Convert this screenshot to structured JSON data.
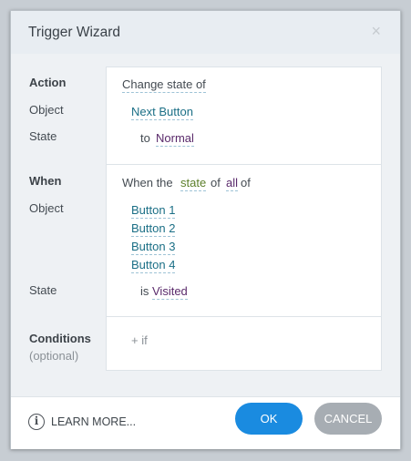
{
  "dialog": {
    "title": "Trigger Wizard",
    "close_glyph": "×"
  },
  "action_section": {
    "heading": "Action",
    "object_label": "Object",
    "state_label": "State",
    "action_value": "Change state of",
    "object_value": "Next Button",
    "state_prefix": "to",
    "state_value": "Normal"
  },
  "when_section": {
    "heading": "When",
    "object_label": "Object",
    "state_label": "State",
    "sentence": {
      "part1": "When the",
      "state_word": "state",
      "part2": "of",
      "all_word": "all",
      "part3": "of"
    },
    "objects": [
      "Button 1",
      "Button 2",
      "Button 3",
      "Button 4"
    ],
    "state_prefix": "is",
    "state_value": "Visited"
  },
  "conditions_section": {
    "heading": "Conditions",
    "subheading": "(optional)",
    "add_label": "+ if"
  },
  "footer": {
    "info_glyph": "i",
    "learn_more": "LEARN MORE...",
    "ok_label": "OK",
    "cancel_label": "CANCEL"
  },
  "colors": {
    "primary_button": "#1a8be0",
    "secondary_button": "#a7adb3",
    "object_link": "#1b6f86",
    "state_link": "#5a2a6b"
  }
}
